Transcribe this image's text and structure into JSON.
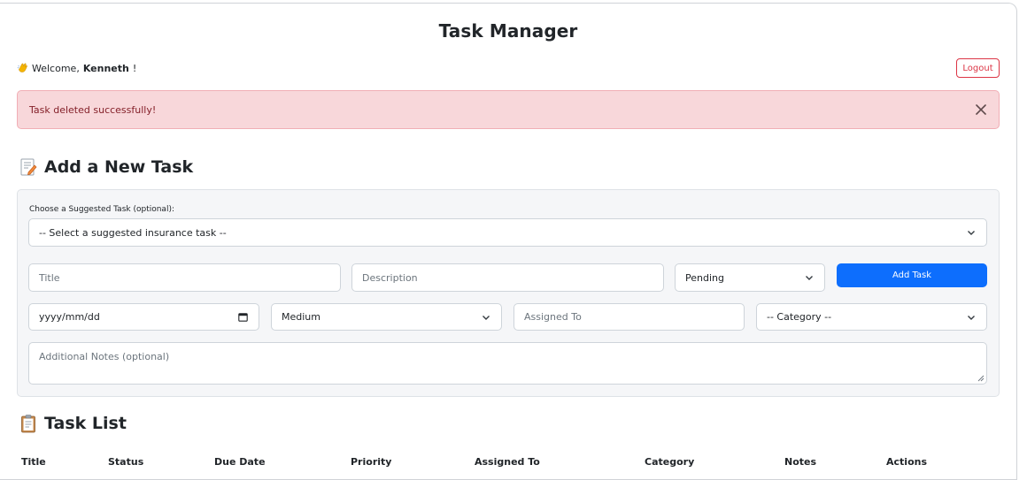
{
  "app": {
    "title": "Task Manager"
  },
  "header": {
    "welcome_prefix": "Welcome, ",
    "username": "Kenneth",
    "welcome_suffix": "!",
    "wave_icon": "waving-hand-icon",
    "logout_label": "Logout"
  },
  "alert": {
    "message": "Task deleted successfully!",
    "close_icon": "close-icon",
    "background": "#f8d7da",
    "text_color": "#842029"
  },
  "add_task": {
    "heading": "Add a New Task",
    "heading_icon": "memo-icon",
    "suggested_label": "Choose a Suggested Task (optional):",
    "suggested_select_value": "-- Select a suggested insurance task --",
    "title_placeholder": "Title",
    "description_placeholder": "Description",
    "status_value": "Pending",
    "add_button_label": "Add Task",
    "date_placeholder": "yyyy/mm/dd",
    "priority_value": "Medium",
    "assigned_placeholder": "Assigned To",
    "category_value": "-- Category --",
    "notes_placeholder": "Additional Notes (optional)"
  },
  "task_list": {
    "heading": "Task List",
    "heading_icon": "clipboard-icon",
    "columns": [
      "Title",
      "Status",
      "Due Date",
      "Priority",
      "Assigned To",
      "Category",
      "Notes",
      "Actions"
    ]
  },
  "colors": {
    "primary": "#0d6efd",
    "danger": "#dc3545",
    "card_background": "#f5f6f8"
  }
}
